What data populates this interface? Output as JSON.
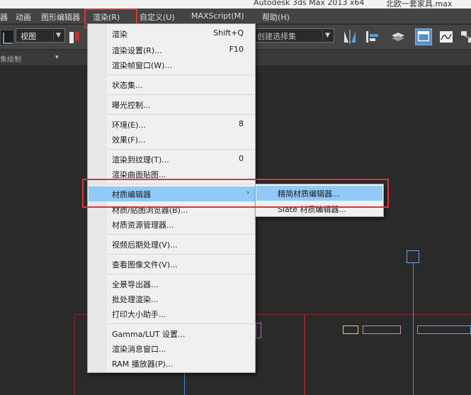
{
  "window": {
    "app_title": "Autodesk 3ds Max  2013 x64",
    "file_title": "北欧一套家具.max"
  },
  "menubar": {
    "items": [
      {
        "label": "器"
      },
      {
        "label": "动画"
      },
      {
        "label": "图形编辑器"
      },
      {
        "label": "渲染(R)"
      },
      {
        "label": "自定义(U)"
      },
      {
        "label": "MAXScript(M)"
      },
      {
        "label": "帮助(H)"
      }
    ],
    "active": "渲染(R)"
  },
  "toolbar": {
    "view_select_value": "视图",
    "selection_set_value": "创建选择集"
  },
  "subbar": {
    "label": "象绘制",
    "mini_dropdown": "▾"
  },
  "render_menu": {
    "items": [
      {
        "label": "渲染",
        "shortcut": "Shift+Q"
      },
      {
        "label": "渲染设置(R)...",
        "shortcut": "F10"
      },
      {
        "label": "渲染帧窗口(W)...",
        "shortcut": ""
      },
      {
        "label": "状态集...",
        "shortcut": ""
      },
      {
        "label": "曝光控制...",
        "shortcut": ""
      },
      {
        "label": "环境(E)...",
        "shortcut": "8"
      },
      {
        "label": "效果(F)...",
        "shortcut": ""
      },
      {
        "label": "渲染到纹理(T)...",
        "shortcut": "0"
      },
      {
        "label": "渲染曲面贴图...",
        "shortcut": ""
      },
      {
        "label": "材质编辑器",
        "shortcut": ""
      },
      {
        "label": "材质/贴图浏览器(B)...",
        "shortcut": ""
      },
      {
        "label": "材质资源管理器...",
        "shortcut": ""
      },
      {
        "label": "视频后期处理(V)...",
        "shortcut": ""
      },
      {
        "label": "查看图像文件(V)...",
        "shortcut": ""
      },
      {
        "label": "全景导出器...",
        "shortcut": ""
      },
      {
        "label": "批处理渲染...",
        "shortcut": ""
      },
      {
        "label": "打印大小助手...",
        "shortcut": ""
      },
      {
        "label": "Gamma/LUT 设置...",
        "shortcut": ""
      },
      {
        "label": "渲染消息窗口...",
        "shortcut": ""
      },
      {
        "label": "RAM 播放器(P)...",
        "shortcut": ""
      }
    ],
    "highlighted": "材质编辑器",
    "submenu_arrow": "›"
  },
  "material_editor_submenu": {
    "items": [
      {
        "label": "精简材质编辑器..."
      },
      {
        "label": "Slate 材质编辑器..."
      }
    ],
    "highlighted": "精简材质编辑器..."
  },
  "colors": {
    "highlight": "#91c9f7",
    "annotation_red": "#d8353b",
    "ui_dark": "#444444",
    "viewport": "#2a2a2a"
  }
}
